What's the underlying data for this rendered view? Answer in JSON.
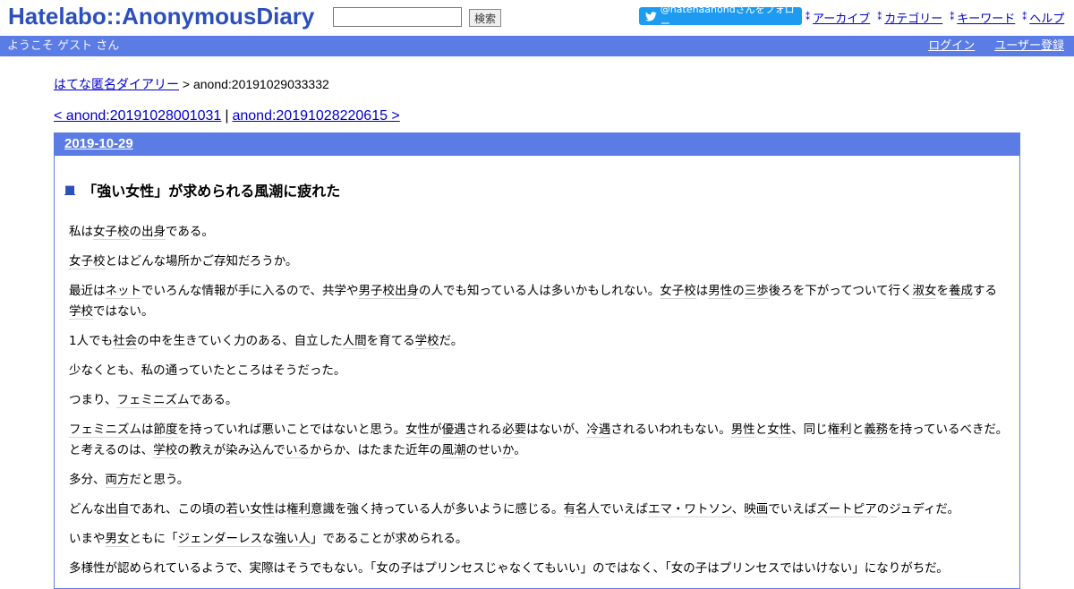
{
  "header": {
    "logo": "Hatelabo::AnonymousDiary",
    "search_value": "",
    "search_button": "検索",
    "follow_label": "@hatenaanondさんをフォロー",
    "nav": [
      "アーカイブ",
      "カテゴリー",
      "キーワード",
      "ヘルプ"
    ]
  },
  "bar": {
    "welcome": "ようこそ ゲスト さん",
    "login": "ログイン",
    "register": "ユーザー登録"
  },
  "breadcrumb": {
    "home": "はてな匿名ダイアリー",
    "sep": " > ",
    "current": "anond:20191029033332"
  },
  "pager": {
    "prev": "< anond:20191028001031",
    "sep": "|",
    "next": "anond:20191028220615 >"
  },
  "entry": {
    "date": "2019-10-29",
    "mark": "■",
    "title": "「強い女性」が求められる風潮に疲れた",
    "paragraphs": [
      [
        {
          "t": "私は"
        },
        {
          "t": "女子校",
          "k": 1
        },
        {
          "t": "の"
        },
        {
          "t": "出身",
          "k": 1
        },
        {
          "t": "である。"
        }
      ],
      [
        {
          "t": "女子校",
          "k": 1
        },
        {
          "t": "とはどんな場所かご存知だろうか。"
        }
      ],
      [
        {
          "t": "最近は"
        },
        {
          "t": "ネット",
          "k": 1
        },
        {
          "t": "でいろんな情報が手に入るので、共学や"
        },
        {
          "t": "男子校",
          "k": 1
        },
        {
          "t": "出身",
          "k": 1
        },
        {
          "t": "の人でも知っている人は多いかもしれない。"
        },
        {
          "t": "女子校",
          "k": 1
        },
        {
          "t": "は"
        },
        {
          "t": "男性",
          "k": 1
        },
        {
          "t": "の"
        },
        {
          "t": "三歩",
          "k": 1
        },
        {
          "t": "後ろを下がってついて行く"
        },
        {
          "t": "淑女",
          "k": 1
        },
        {
          "t": "を"
        },
        {
          "t": "養成",
          "k": 1
        },
        {
          "t": "する"
        },
        {
          "t": "学校",
          "k": 1
        },
        {
          "t": "ではない。"
        }
      ],
      [
        {
          "t": "1人でも"
        },
        {
          "t": "社会",
          "k": 1
        },
        {
          "t": "の中を生きていく力のある、自立した"
        },
        {
          "t": "人間",
          "k": 1
        },
        {
          "t": "を育てる"
        },
        {
          "t": "学校",
          "k": 1
        },
        {
          "t": "だ。"
        }
      ],
      [
        {
          "t": "少なくとも、私の通っていたところはそうだった。"
        }
      ],
      [
        {
          "t": "つまり、"
        },
        {
          "t": "フェミニズム",
          "k": 1
        },
        {
          "t": "である。"
        }
      ],
      [
        {
          "t": "フェミニズム",
          "k": 1
        },
        {
          "t": "は"
        },
        {
          "t": "節度",
          "k": 1
        },
        {
          "t": "を持っていれば悪いことではないと思う。"
        },
        {
          "t": "女性",
          "k": 1
        },
        {
          "t": "が"
        },
        {
          "t": "優遇",
          "k": 1
        },
        {
          "t": "される"
        },
        {
          "t": "必要",
          "k": 1
        },
        {
          "t": "はないが、"
        },
        {
          "t": "冷遇",
          "k": 1
        },
        {
          "t": "されるいわれもない。"
        },
        {
          "t": "男性",
          "k": 1
        },
        {
          "t": "と"
        },
        {
          "t": "女性",
          "k": 1
        },
        {
          "t": "、同じ"
        },
        {
          "t": "権利",
          "k": 1
        },
        {
          "t": "と"
        },
        {
          "t": "義務",
          "k": 1
        },
        {
          "t": "を持っているべきだ。と考えるのは、"
        },
        {
          "t": "学校",
          "k": 1
        },
        {
          "t": "の教えが染み込んで"
        },
        {
          "t": "いる",
          "k": 1
        },
        {
          "t": "からか、はたまた近年の"
        },
        {
          "t": "風潮",
          "k": 1
        },
        {
          "t": "のせい"
        },
        {
          "t": "か",
          "k": 1
        },
        {
          "t": "。"
        }
      ],
      [
        {
          "t": "多分、"
        },
        {
          "t": "両方",
          "k": 1
        },
        {
          "t": "だと思う。"
        }
      ],
      [
        {
          "t": "どんな"
        },
        {
          "t": "出自",
          "k": 1
        },
        {
          "t": "であれ、この頃の"
        },
        {
          "t": "若い",
          "k": 1
        },
        {
          "t": "女性",
          "k": 1
        },
        {
          "t": "は"
        },
        {
          "t": "権利意識",
          "k": 1
        },
        {
          "t": "を強く持っている人が多いように感じる。"
        },
        {
          "t": "有名人",
          "k": 1
        },
        {
          "t": "でいえば"
        },
        {
          "t": "エマ・ワトソン",
          "k": 1
        },
        {
          "t": "、"
        },
        {
          "t": "映画",
          "k": 1
        },
        {
          "t": "でいえば"
        },
        {
          "t": "ズートピア",
          "k": 1
        },
        {
          "t": "のジュディだ。"
        }
      ],
      [
        {
          "t": "いまや"
        },
        {
          "t": "男女",
          "k": 1
        },
        {
          "t": "ともに「"
        },
        {
          "t": "ジェンダーレス",
          "k": 1
        },
        {
          "t": "な"
        },
        {
          "t": "強い人",
          "k": 1
        },
        {
          "t": "」である",
          "k": 0
        },
        {
          "t": "ことが求められる。"
        }
      ],
      [
        {
          "t": "多様性が認められているようで、実際はそうでもない。「女の子はプリンセスじゃなくてもいい」のではなく、「女の子はプリンセスではいけない」になりがちだ。"
        }
      ]
    ]
  }
}
